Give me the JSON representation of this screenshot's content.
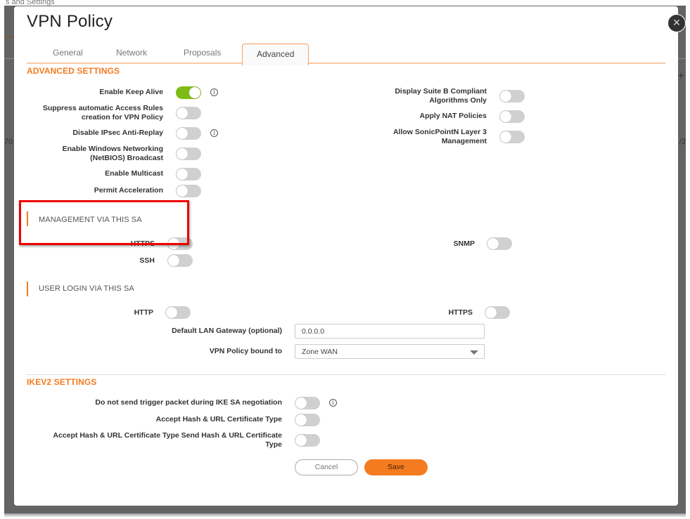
{
  "background": {
    "top_text": "s and Settings",
    "left_fragment": "70",
    "right_fragment": "/2"
  },
  "dialog": {
    "title": "VPN Policy",
    "close_icon": "close-icon"
  },
  "tabs": [
    {
      "label": "General",
      "active": false
    },
    {
      "label": "Network",
      "active": false
    },
    {
      "label": "Proposals",
      "active": false
    },
    {
      "label": "Advanced",
      "active": true
    }
  ],
  "advanced_settings": {
    "title": "ADVANCED SETTINGS",
    "left": [
      {
        "label": "Enable Keep Alive",
        "on": true,
        "info": true
      },
      {
        "label_line1": "Suppress automatic Access Rules",
        "label_line2": "creation for VPN Policy",
        "on": false,
        "info": false
      },
      {
        "label": "Disable IPsec Anti-Replay",
        "on": false,
        "info": true
      },
      {
        "label_line1": "Enable Windows Networking",
        "label_line2": "(NetBIOS) Broadcast",
        "on": false,
        "info": false
      },
      {
        "label": "Enable Multicast",
        "on": false,
        "info": false
      },
      {
        "label": "Permit Acceleration",
        "on": false,
        "info": false
      }
    ],
    "right": [
      {
        "label_line1": "Display Suite B Compliant",
        "label_line2": "Algorithms Only",
        "on": false
      },
      {
        "label": "Apply NAT Policies",
        "on": false
      },
      {
        "label_line1": "Allow SonicPointN Layer 3",
        "label_line2": "Management",
        "on": false
      }
    ]
  },
  "management": {
    "title": "MANAGEMENT VIA THIS SA",
    "https_label": "HTTPS",
    "https_on": false,
    "ssh_label": "SSH",
    "ssh_on": false,
    "snmp_label": "SNMP",
    "snmp_on": false,
    "highlight_color": "#e00000"
  },
  "user_login": {
    "title": "USER LOGIN VIA THIS SA",
    "http_label": "HTTP",
    "http_on": false,
    "https_label": "HTTPS",
    "https_on": false,
    "gateway_label": "Default LAN Gateway (optional)",
    "gateway_value": "0.0.0.0",
    "bound_label": "VPN Policy bound to",
    "bound_value": "Zone WAN"
  },
  "ikev2": {
    "title": "IKEV2 SETTINGS",
    "items": [
      {
        "label": "Do not send trigger packet during IKE SA negotiation",
        "on": false,
        "info": true
      },
      {
        "label": "Accept Hash & URL Certificate Type",
        "on": false,
        "info": false
      },
      {
        "label_line1": "Accept Hash & URL Certificate Type Send Hash & URL Certificate",
        "label_line2": "Type",
        "on": false,
        "info": false
      }
    ]
  },
  "buttons": {
    "cancel": "Cancel",
    "save": "Save"
  },
  "colors": {
    "accent": "#f47b20",
    "toggle_on": "#7ebc15",
    "toggle_off": "#d0d0d0"
  }
}
